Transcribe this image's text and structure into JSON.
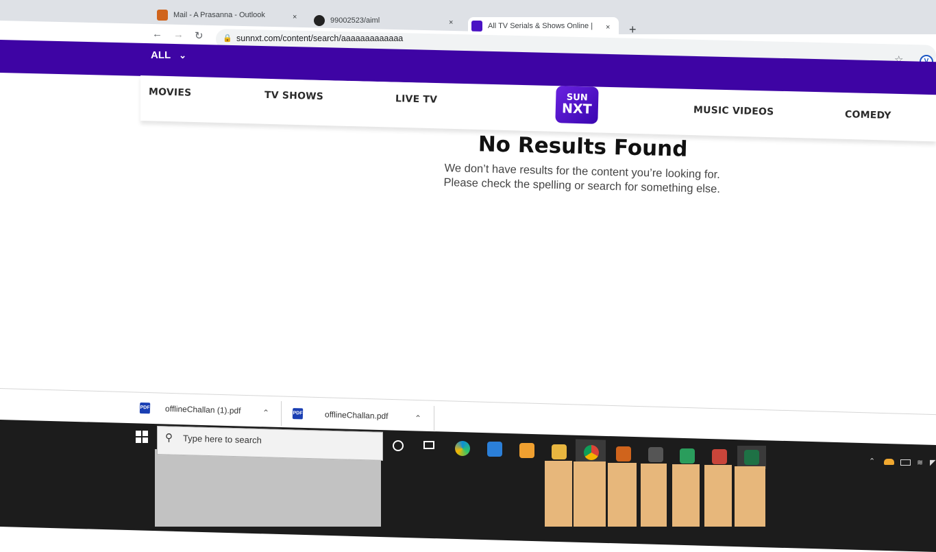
{
  "browser": {
    "tabs": [
      {
        "title": "Mail - A Prasanna - Outlook",
        "icon": "outlook-icon",
        "active": false
      },
      {
        "title": "99002523/aiml",
        "icon": "github-icon",
        "active": false
      },
      {
        "title": "All TV Serials & Shows Online | W",
        "icon": "sunnxt-icon",
        "active": true
      }
    ],
    "new_tab_label": "+",
    "url": "sunnxt.com/content/search/aaaaaaaaaaaaa",
    "close_glyph": "×"
  },
  "site": {
    "category_dropdown": "ALL",
    "nav": {
      "movies": "MOVIES",
      "tv_shows": "TV SHOWS",
      "live_tv": "LIVE TV",
      "music_videos": "MUSIC VIDEOS",
      "comedy": "COMEDY"
    },
    "logo_top": "SUN",
    "logo_bottom": "NXT",
    "brand_color": "#3e04a4"
  },
  "results": {
    "title": "No Results Found",
    "line1": "We don’t have results for the content you’re looking for.",
    "line2": "Please check the spelling or search for something else."
  },
  "downloads": [
    {
      "file": "offlineChallan (1).pdf",
      "badge": "PDF"
    },
    {
      "file": "offlineChallan.pdf",
      "badge": "PDF"
    }
  ],
  "taskbar": {
    "search_placeholder": "Type here to search",
    "pinned": [
      "cortana-icon",
      "task-view-icon",
      "edge-icon",
      "store-icon",
      "mail-icon",
      "file-explorer-icon",
      "chrome-icon",
      "outlook-icon",
      "terminal-icon",
      "sticky-notes-icon",
      "teams-icon",
      "excel-icon"
    ]
  }
}
